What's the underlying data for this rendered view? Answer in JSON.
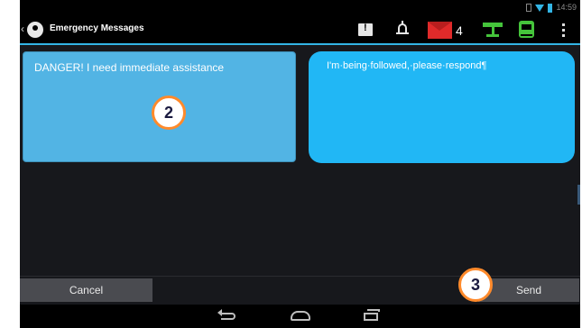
{
  "status_bar": {
    "time": "14:59"
  },
  "action_bar": {
    "title": "Emergency Messages",
    "mail_count": "4",
    "icons": [
      "alert-icon",
      "bell-icon",
      "mail-icon",
      "signpost-icon",
      "bus-icon",
      "overflow-menu-icon"
    ]
  },
  "messages": {
    "left_text": "DANGER! I need immediate assistance",
    "right_text": "I'm·being·followed,·please·respond¶"
  },
  "callouts": {
    "left": "2",
    "right": "3"
  },
  "buttons": {
    "cancel": "Cancel",
    "send": "Send"
  },
  "colors": {
    "accent": "#33b5e5",
    "tile_left": "#52b4e4",
    "tile_right": "#21b7f5",
    "callout_border": "#ff8a2b",
    "green_icons": "#45c43b",
    "mail_red": "#e02a2a"
  }
}
